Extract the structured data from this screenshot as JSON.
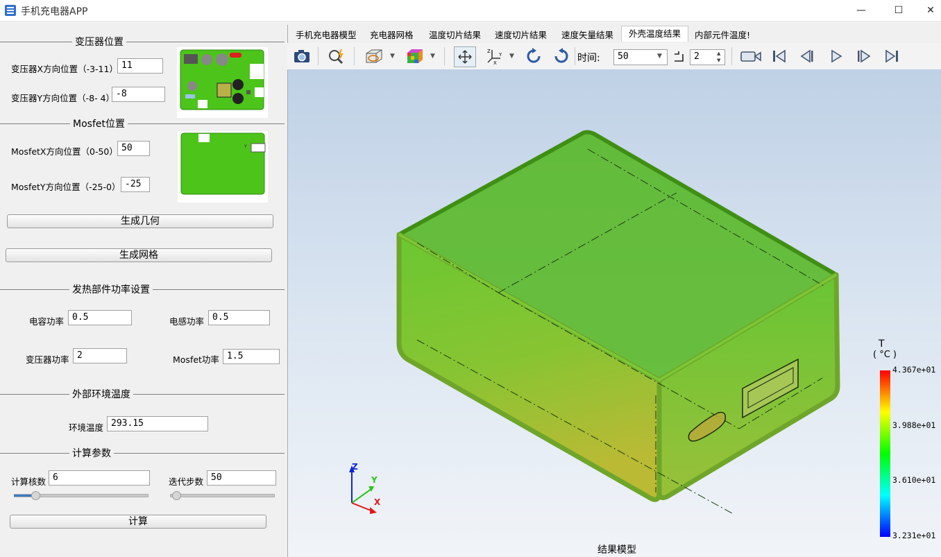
{
  "window": {
    "title": "手机充电器APP",
    "minimize_glyph": "—",
    "maximize_glyph": "☐",
    "close_glyph": "✕"
  },
  "transformer": {
    "section_title": "变压器位置",
    "x_label": "变压器X方向位置（-3-11）",
    "x_value": "11",
    "y_label": "变压器Y方向位置（-8- 4）",
    "y_value": "-8"
  },
  "mosfet": {
    "section_title": "Mosfet位置",
    "x_label": "MosfetX方向位置（0-50）",
    "x_value": "50",
    "y_label": "MosfetY方向位置（-25-0）",
    "y_value": "-25"
  },
  "buttons": {
    "generate_geometry": "生成几何",
    "generate_mesh": "生成网格",
    "compute": "计算"
  },
  "power": {
    "section_title": "发热部件功率设置",
    "capacitor_label": "电容功率",
    "capacitor_value": "0.5",
    "inductor_label": "电感功率",
    "inductor_value": "0.5",
    "transformer_label": "变压器功率",
    "transformer_value": "2",
    "mosfet_label": "Mosfet功率",
    "mosfet_value": "1.5"
  },
  "ambient": {
    "section_title": "外部环境温度",
    "label": "环境温度",
    "value": "293.15"
  },
  "compute": {
    "section_title": "计算参数",
    "cores_label": "计算核数",
    "cores_value": "6",
    "iterations_label": "迭代步数",
    "iterations_value": "50",
    "cores_slider_fraction": 0.08,
    "iterations_slider_fraction": 0.02
  },
  "tabs": [
    {
      "label": "手机充电器模型"
    },
    {
      "label": "充电器网格"
    },
    {
      "label": "温度切片结果"
    },
    {
      "label": "速度切片结果"
    },
    {
      "label": "速度矢量结果"
    },
    {
      "label": "外壳温度结果",
      "active": true
    },
    {
      "label": "内部元件温度!"
    }
  ],
  "toolbar": {
    "time_label": "时间:",
    "time_value": "50",
    "step_value": "2",
    "icons": [
      "camera-icon",
      "zoom-icon",
      "display-style-icon",
      "color-cube-icon",
      "fit-view-icon",
      "axis-orientation-icon",
      "rotate-cw-icon",
      "rotate-ccw-icon",
      "record-icon",
      "first-frame-icon",
      "prev-frame-icon",
      "play-icon",
      "next-frame-icon",
      "last-frame-icon"
    ]
  },
  "colorbar": {
    "title_var": "T",
    "title_unit": "( °C )",
    "labels": [
      "4.367e+01",
      "3.988e+01",
      "3.610e+01",
      "3.231e+01"
    ],
    "colors": [
      "#ff0000",
      "#ffff00",
      "#00ff00",
      "#00ffff",
      "#0000ff"
    ]
  },
  "axes": {
    "z": "Z",
    "y": "Y",
    "x": "X"
  },
  "viewport_caption": "结果模型",
  "colors": {
    "accent_blue": "#3b7bc4",
    "model_green": "#5cc416",
    "model_yellow": "#b3b31a"
  }
}
